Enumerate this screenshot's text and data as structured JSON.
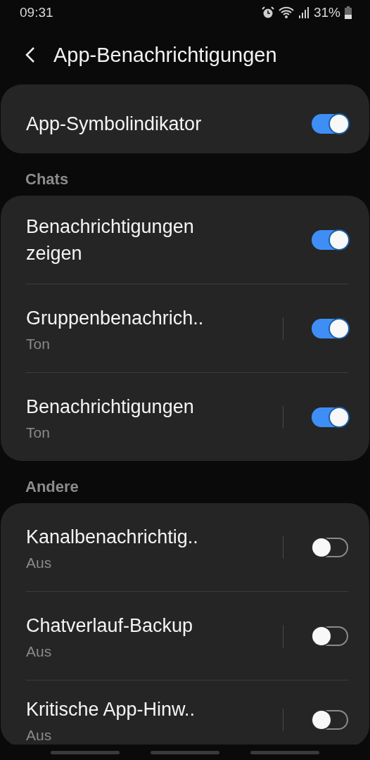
{
  "status_bar": {
    "time": "09:31",
    "battery": "31%"
  },
  "header": {
    "title": "App-Benachrichtigungen"
  },
  "top_setting": {
    "title": "App-Symbolindikator",
    "on": true
  },
  "sections": [
    {
      "title": "Chats",
      "items": [
        {
          "title": "Benachrichtigungen zeigen",
          "split": false,
          "on": true
        },
        {
          "title": "Gruppenbenachrich..",
          "subtitle": "Ton",
          "split": true,
          "on": true
        },
        {
          "title": "Benachrichtigungen",
          "subtitle": "Ton",
          "split": true,
          "on": true
        }
      ]
    },
    {
      "title": "Andere",
      "items": [
        {
          "title": "Kanalbenachrichtig..",
          "subtitle": "Aus",
          "split": true,
          "on": false
        },
        {
          "title": "Chatverlauf-Backup",
          "subtitle": "Aus",
          "split": true,
          "on": false
        },
        {
          "title": "Kritische App-Hinw..",
          "subtitle": "Aus",
          "split": true,
          "on": false
        }
      ]
    }
  ]
}
